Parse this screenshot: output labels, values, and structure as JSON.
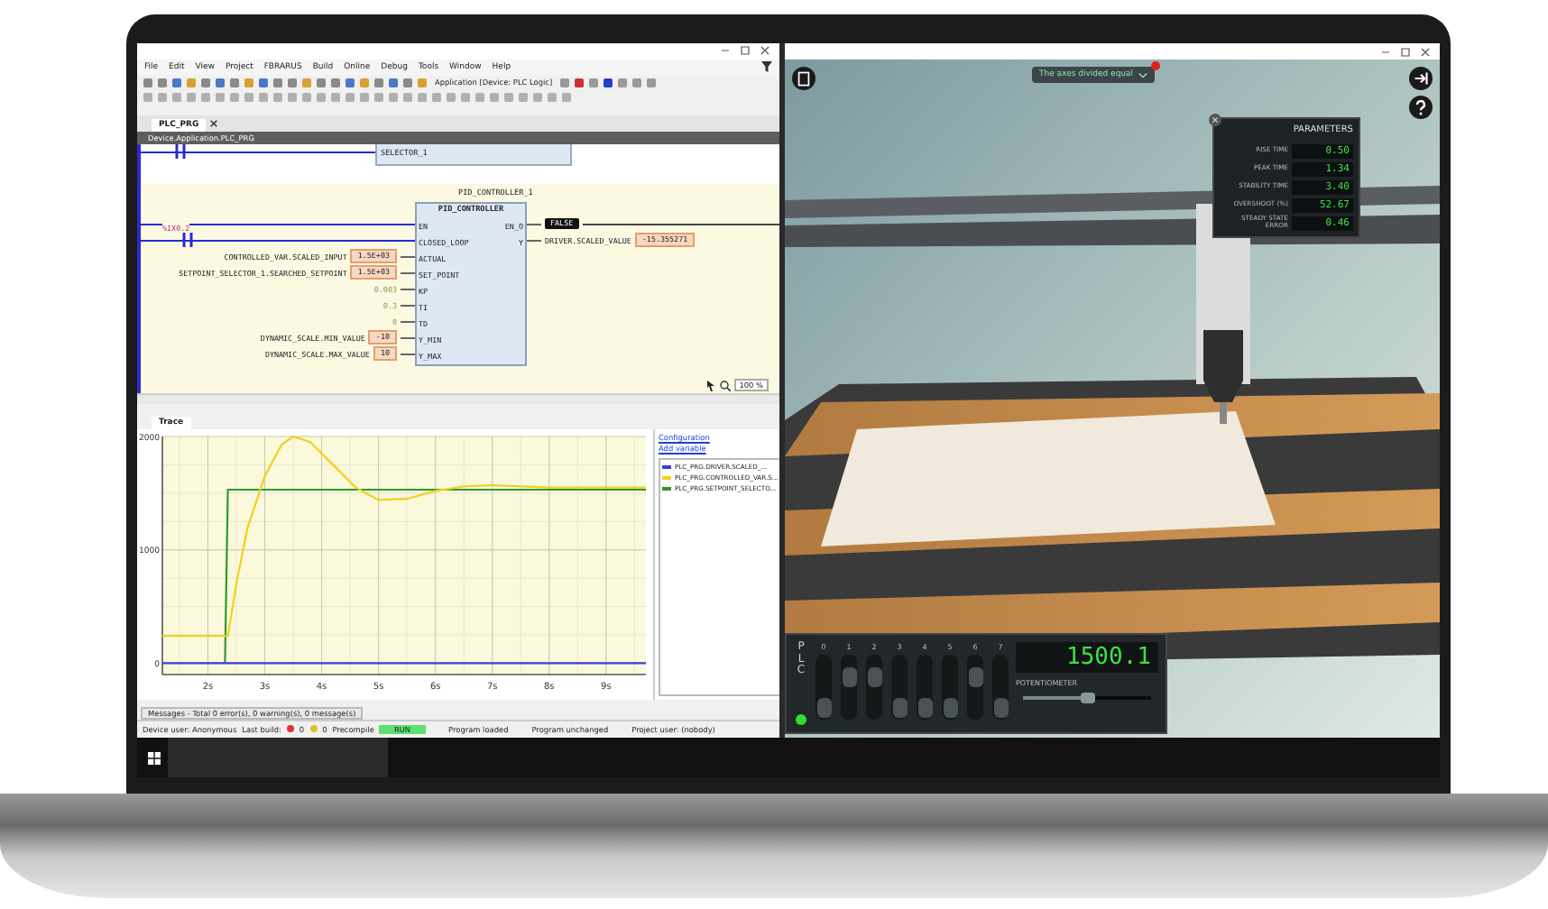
{
  "ide": {
    "menu": [
      "File",
      "Edit",
      "View",
      "Project",
      "FBRARUS",
      "Build",
      "Online",
      "Debug",
      "Tools",
      "Window",
      "Help"
    ],
    "device_selector": "Application [Device: PLC Logic]",
    "editor_tab": {
      "label": "PLC_PRG",
      "selected": true
    },
    "breadcrumb": "Device.Application.PLC_PRG",
    "ladder": {
      "selector_block": "SELECTOR_1",
      "instance": "PID_CONTROLLER_1",
      "block_type": "PID_CONTROLLER",
      "inputs": [
        {
          "kind": "wire",
          "pin": "EN"
        },
        {
          "kind": "contact",
          "pin": "CLOSED_LOOP",
          "label": "%IX0.2"
        },
        {
          "kind": "variable",
          "pin": "ACTUAL",
          "variable": "CONTROLLED_VAR.SCALED_INPUT",
          "value": "1.5E+03"
        },
        {
          "kind": "variable",
          "pin": "SET_POINT",
          "variable": "SETPOINT_SELECTOR_1.SEARCHED_SETPOINT",
          "value": "1.5E+03"
        },
        {
          "kind": "constant",
          "pin": "KP",
          "value": "0.003"
        },
        {
          "kind": "constant",
          "pin": "TI",
          "value": "0.3"
        },
        {
          "kind": "constant",
          "pin": "TD",
          "value": "0"
        },
        {
          "kind": "variable",
          "pin": "Y_MIN",
          "variable": "DYNAMIC_SCALE.MIN_VALUE",
          "value": "-10"
        },
        {
          "kind": "variable",
          "pin": "Y_MAX",
          "variable": "DYNAMIC_SCALE.MAX_VALUE",
          "value": "10"
        }
      ],
      "outputs": [
        {
          "kind": "flag",
          "pin": "EN_O",
          "value": "FALSE"
        },
        {
          "kind": "variable",
          "pin": "Y",
          "variable": "DRIVER.SCALED_VALUE",
          "value": "-15.355271"
        }
      ],
      "zoom": "100 %"
    },
    "trace": {
      "tab": "Trace",
      "links": [
        "Configuration",
        "Add variable"
      ],
      "chart_data": {
        "type": "line",
        "x": [
          1.2,
          1.6,
          2.0,
          2.3,
          2.35,
          2.5,
          2.7,
          3.0,
          3.3,
          3.5,
          3.8,
          4.2,
          4.6,
          5.0,
          5.5,
          6.0,
          6.5,
          7.0,
          7.5,
          8.0,
          8.5,
          9.0,
          9.7
        ],
        "series": [
          {
            "name": "PLC_PRG.DRIVER.SCALED_...",
            "color": "#3c3cd8",
            "values": [
              0,
              0,
              0,
              0,
              0,
              0,
              0,
              0,
              0,
              0,
              0,
              0,
              0,
              0,
              0,
              0,
              0,
              0,
              0,
              0,
              0,
              0,
              0
            ]
          },
          {
            "name": "PLC_PRG.CONTROLLED_VAR.S...",
            "color": "#f0d020",
            "values": [
              240,
              240,
              240,
              240,
              240,
              700,
              1200,
              1650,
              1930,
              2000,
              1950,
              1750,
              1550,
              1440,
              1450,
              1520,
              1560,
              1570,
              1560,
              1550,
              1550,
              1550,
              1550
            ]
          },
          {
            "name": "PLC_PRG.SETPOINT_SELECTO...",
            "color": "#2e9a2e",
            "values": [
              null,
              null,
              null,
              0,
              1530,
              1530,
              1530,
              1530,
              1530,
              1530,
              1530,
              1530,
              1530,
              1530,
              1530,
              1530,
              1530,
              1530,
              1530,
              1530,
              1530,
              1530,
              1530
            ]
          }
        ],
        "xlim": [
          1.2,
          9.7
        ],
        "ylim": [
          -100,
          2000
        ],
        "grid": true,
        "xticks": [
          {
            "value": 2,
            "label": "2s"
          },
          {
            "value": 3,
            "label": "3s"
          },
          {
            "value": 4,
            "label": "4s"
          },
          {
            "value": 5,
            "label": "5s"
          },
          {
            "value": 6,
            "label": "6s"
          },
          {
            "value": 7,
            "label": "7s"
          },
          {
            "value": 8,
            "label": "8s"
          },
          {
            "value": 9,
            "label": "9s"
          }
        ],
        "yticks": [
          0,
          1000,
          2000
        ]
      }
    },
    "messages_tab": "Messages - Total 0 error(s), 0 warning(s), 0 message(s)",
    "status_bar": {
      "device_user": "Device user: Anonymous",
      "last_build": "Last build:",
      "errors": "0",
      "warnings": "0",
      "precompile": "Precompile",
      "run_state": "RUN",
      "program_state": "Program loaded",
      "changes": "Program unchanged",
      "project_user": "Project user: (nobody)"
    }
  },
  "simulator": {
    "banner": "The axes divided equal",
    "notification": true,
    "parameters": {
      "title": "PARAMETERS",
      "rows": [
        {
          "label": "RISE TIME",
          "value": "0.50"
        },
        {
          "label": "PEAK TIME",
          "value": "1.34"
        },
        {
          "label": "STABILITY TIME",
          "value": "3.40"
        },
        {
          "label": "OVERSHOOT (%)",
          "value": "52.67"
        },
        {
          "label": "STEADY STATE ERROR",
          "value": "0.46"
        }
      ]
    },
    "plc": {
      "label": "PLC",
      "led_on": true,
      "switches": [
        {
          "label": "0",
          "on": false
        },
        {
          "label": "1",
          "on": true
        },
        {
          "label": "2",
          "on": true
        },
        {
          "label": "3",
          "on": false
        },
        {
          "label": "4",
          "on": false
        },
        {
          "label": "5",
          "on": false
        },
        {
          "label": "6",
          "on": true
        },
        {
          "label": "7",
          "on": false
        }
      ],
      "display": "1500.1",
      "potentiometer": {
        "label": "POTENTIOMETER",
        "level": 0.5
      }
    }
  }
}
